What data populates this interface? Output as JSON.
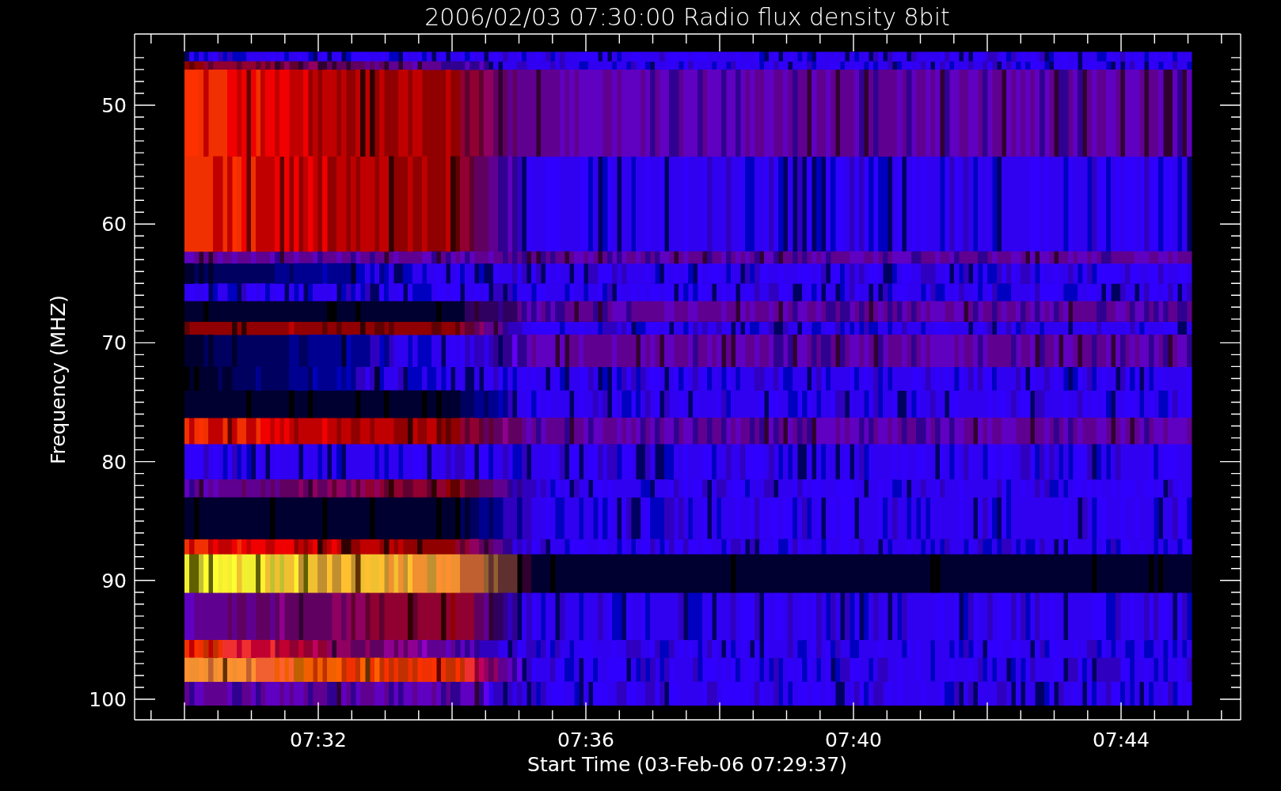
{
  "title": "2006/02/03 07:30:00 Radio flux density 8bit",
  "y_axis": {
    "label": "Frequency (MHZ)",
    "ticks": [
      "50",
      "60",
      "70",
      "80",
      "90",
      "100"
    ]
  },
  "x_axis": {
    "label": "Start Time (03-Feb-06 07:29:37)",
    "ticks": [
      "07:32",
      "07:36",
      "07:40",
      "07:44"
    ]
  }
}
